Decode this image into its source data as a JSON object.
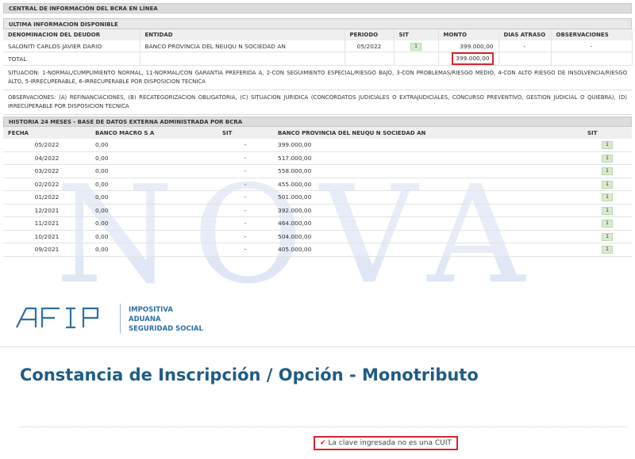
{
  "watermark": "NOVA",
  "bcra": {
    "title": "CENTRAL DE INFORMACIÓN DEL BCRA EN LÍNEA",
    "subtitle": "ULTIMA INFORMACION DISPONIBLE",
    "columns": [
      "DENOMINACION DEL DEUDOR",
      "ENTIDAD",
      "PERIODO",
      "SIT",
      "MONTO",
      "DIAS ATRASO",
      "OBSERVACIONES"
    ],
    "row": {
      "deudor": "SALONITI CARLOS JAVIER DARIO",
      "entidad": "BANCO PROVINCIA DEL NEUQU N SOCIEDAD AN",
      "periodo": "05/2022",
      "sit": "1",
      "monto": "399.000,00",
      "dias": "-",
      "obs": "-"
    },
    "total_label": "TOTAL",
    "total_monto": "399.000,00",
    "situacion_text": "SITUACION: 1-NORMAL/CUMPLIMIENTO NORMAL, 11-NORMAL/CON GARANTIA PREFERIDA A, 2-CON SEGUIMIENTO ESPECIAL/RIESGO BAJO, 3-CON PROBLEMAS/RIESGO MEDIO, 4-CON ALTO RIESGO DE INSOLVENCIA/RIESGO ALTO, 5-IRRECUPERABLE, 6-IRRECUPERABLE POR DISPOSICION TECNICA",
    "observaciones_text": "OBSERVACIONES: (A) REFINANCIACIONES, (B) RECATEGORIZACION OBLIGATORIA, (C) SITUACION JURIDICA (CONCORDATOS JUDICIALES O EXTRAJUDICIALES, CONCURSO PREVENTIVO, GESTION JUDICIAL O QUIEBRA), (D) IRRECUPERABLE POR DISPOSICION TECNICA",
    "history_title": "HISTORIA 24 MESES - BASE DE DATOS EXTERNA ADMINISTRADA POR BCRA",
    "history_columns": [
      "FECHA",
      "BANCO MACRO S A",
      "SIT",
      "BANCO PROVINCIA DEL NEUQU N SOCIEDAD AN",
      "SIT"
    ],
    "history": [
      {
        "fecha": "05/2022",
        "macro": "0,00",
        "sit1": "-",
        "prov": "399.000,00",
        "sit2": "1"
      },
      {
        "fecha": "04/2022",
        "macro": "0,00",
        "sit1": "-",
        "prov": "517.000,00",
        "sit2": "1"
      },
      {
        "fecha": "03/2022",
        "macro": "0,00",
        "sit1": "-",
        "prov": "558.000,00",
        "sit2": "1"
      },
      {
        "fecha": "02/2022",
        "macro": "0,00",
        "sit1": "-",
        "prov": "455.000,00",
        "sit2": "1"
      },
      {
        "fecha": "01/2022",
        "macro": "0,00",
        "sit1": "-",
        "prov": "501.000,00",
        "sit2": "1"
      },
      {
        "fecha": "12/2021",
        "macro": "0,00",
        "sit1": "-",
        "prov": "392.000,00",
        "sit2": "1"
      },
      {
        "fecha": "11/2021",
        "macro": "0,00",
        "sit1": "-",
        "prov": "464.000,00",
        "sit2": "1"
      },
      {
        "fecha": "10/2021",
        "macro": "0,00",
        "sit1": "-",
        "prov": "504.000,00",
        "sit2": "1"
      },
      {
        "fecha": "09/2021",
        "macro": "0,00",
        "sit1": "-",
        "prov": "405.000,00",
        "sit2": "1"
      }
    ]
  },
  "afip": {
    "logo_text": "AFIP",
    "lines": [
      "IMPOSITIVA",
      "ADUANA",
      "SEGURIDAD SOCIAL"
    ],
    "brand_color": "#2d6fa8"
  },
  "constancia": {
    "title": "Constancia de Inscripción / Opción - Monotributo",
    "error_message": "La clave ingresada no es una CUIT",
    "error_color": "#d9232e"
  }
}
